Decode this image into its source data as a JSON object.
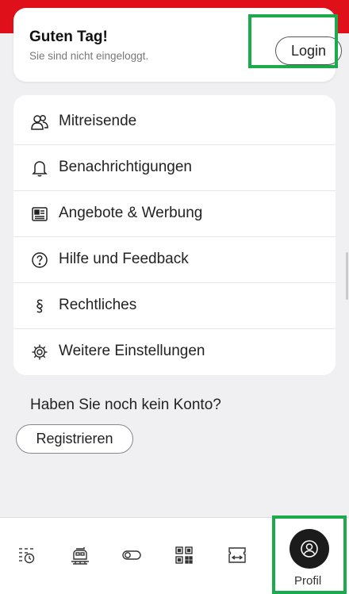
{
  "header": {
    "greeting": "Guten Tag!",
    "status": "Sie sind nicht eingeloggt.",
    "login_label": "Login"
  },
  "menu": {
    "items": [
      {
        "label": "Mitreisende",
        "icon": "people-icon"
      },
      {
        "label": "Benachrichtigungen",
        "icon": "bell-icon"
      },
      {
        "label": "Angebote & Werbung",
        "icon": "newspaper-icon"
      },
      {
        "label": "Hilfe und Feedback",
        "icon": "help-icon"
      },
      {
        "label": "Rechtliches",
        "icon": "section-sign-icon"
      },
      {
        "label": "Weitere Einstellungen",
        "icon": "gear-icon"
      }
    ]
  },
  "account": {
    "prompt": "Haben Sie noch kein Konto?",
    "register_label": "Registrieren"
  },
  "bottom_nav": {
    "items": [
      {
        "icon": "schedule-icon"
      },
      {
        "icon": "train-icon"
      },
      {
        "icon": "toggle-icon"
      },
      {
        "icon": "qr-code-icon"
      },
      {
        "icon": "ticket-icon"
      }
    ],
    "profile_label": "Profil",
    "active_color": "#1b1b1b"
  },
  "colors": {
    "brand_red": "#e0101a",
    "highlight_green": "#1cab4c"
  }
}
